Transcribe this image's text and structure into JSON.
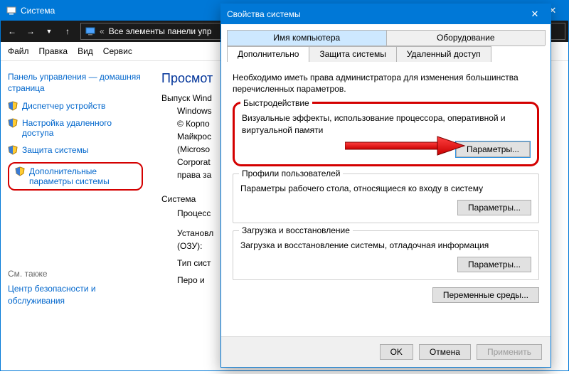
{
  "system_window": {
    "title": "Система",
    "breadcrumb_text": "Все элементы панели упр",
    "menu": {
      "file": "Файл",
      "edit": "Правка",
      "view": "Вид",
      "tools": "Сервис"
    },
    "left": {
      "home": "Панель управления — домашняя страница",
      "devmgr": "Диспетчер устройств",
      "remote": "Настройка удаленного доступа",
      "protection": "Защита системы",
      "advanced": "Дополнительные параметры системы",
      "see_also_label": "См. также",
      "security": "Центр безопасности и обслуживания"
    },
    "right": {
      "h1": "Просмот",
      "edition_label": "Выпуск Wind",
      "edition": "Windows",
      "copyright1": "© Корпо",
      "copyright2": "Майкрос",
      "copyright3": "(Microso",
      "copyright4": "Corporat",
      "copyright5": "права за",
      "system_label": "Система",
      "processor": "Процесс",
      "memory1": "Установл",
      "memory2": "(ОЗУ):",
      "type": "Тип сист",
      "pen": "Перо и"
    }
  },
  "dialog": {
    "title": "Свойства системы",
    "tabs_row1": {
      "computer_name": "Имя компьютера",
      "hardware": "Оборудование"
    },
    "tabs_row2": {
      "advanced": "Дополнительно",
      "protection": "Защита системы",
      "remote": "Удаленный доступ"
    },
    "intro": "Необходимо иметь права администратора для изменения большинства перечисленных параметров.",
    "perf": {
      "legend": "Быстродействие",
      "desc": "Визуальные эффекты, использование процессора, оперативной и виртуальной памяти",
      "button": "Параметры..."
    },
    "profiles": {
      "legend": "Профили пользователей",
      "desc": "Параметры рабочего стола, относящиеся ко входу в систему",
      "button": "Параметры..."
    },
    "startup": {
      "legend": "Загрузка и восстановление",
      "desc": "Загрузка и восстановление системы, отладочная информация",
      "button": "Параметры..."
    },
    "env_button": "Переменные среды...",
    "ok": "OK",
    "cancel": "Отмена",
    "apply": "Применить"
  }
}
